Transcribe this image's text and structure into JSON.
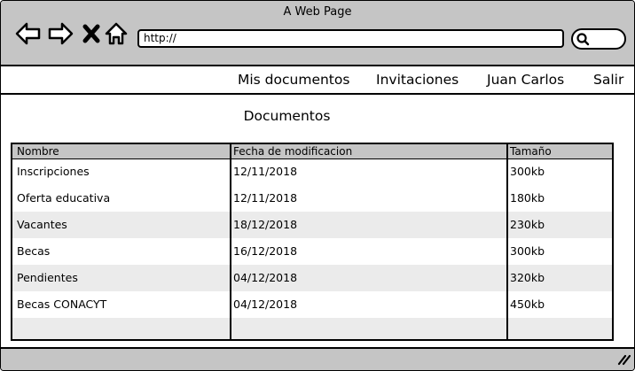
{
  "window": {
    "title": "A Web Page"
  },
  "toolbar": {
    "back_icon": "back-arrow-icon",
    "forward_icon": "forward-arrow-icon",
    "stop_icon": "close-icon",
    "home_icon": "home-icon",
    "url": "http://",
    "search_icon": "search-icon"
  },
  "menu": {
    "items": [
      "Mis documentos",
      "Invitaciones",
      "Juan Carlos",
      "Salir"
    ]
  },
  "main": {
    "title": "Documentos",
    "table": {
      "headers": [
        "Nombre",
        "Fecha de modificacion",
        "Tamaño"
      ],
      "rows": [
        [
          "Inscripciones",
          "12/11/2018",
          "300kb"
        ],
        [
          "Oferta educativa",
          "12/11/2018",
          "180kb"
        ],
        [
          "Vacantes",
          "18/12/2018",
          "230kb"
        ],
        [
          "Becas",
          "16/12/2018",
          "300kb"
        ],
        [
          "Pendientes",
          "04/12/2018",
          "320kb"
        ],
        [
          "Becas CONACYT",
          "04/12/2018",
          "450kb"
        ]
      ]
    }
  },
  "colors": {
    "chrome": "#c5c5c5",
    "row_alt": "#ebebeb",
    "border": "#000000"
  }
}
